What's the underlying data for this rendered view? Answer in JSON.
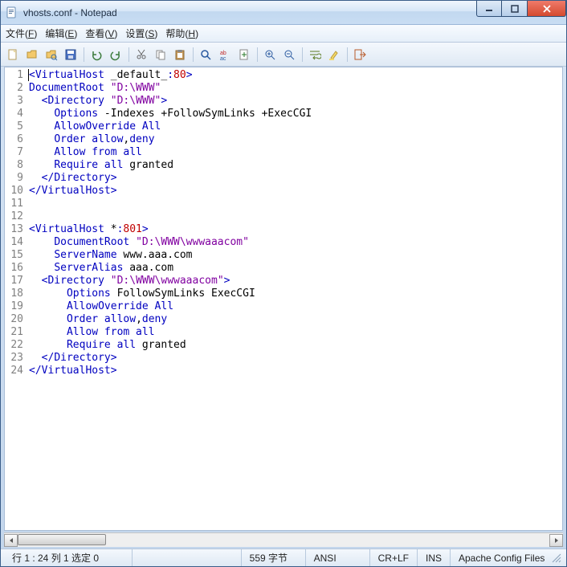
{
  "title": "vhosts.conf - Notepad",
  "menus": {
    "file": "文件(",
    "file_u": "F",
    "file_end": ")",
    "edit": "编辑(",
    "edit_u": "E",
    "edit_end": ")",
    "view": "查看(",
    "view_u": "V",
    "view_end": ")",
    "settings": "设置(",
    "settings_u": "S",
    "settings_end": ")",
    "help": "帮助(",
    "help_u": "H",
    "help_end": ")"
  },
  "lines": [
    {
      "n": 1,
      "tokens": [
        {
          "c": "c-tag",
          "t": "<"
        },
        {
          "c": "c-tag",
          "t": "VirtualHost"
        },
        {
          "c": "c-black",
          "t": " _default_"
        },
        {
          "c": "c-tag",
          "t": ":"
        },
        {
          "c": "c-red",
          "t": "80"
        },
        {
          "c": "c-tag",
          "t": ">"
        }
      ]
    },
    {
      "n": 2,
      "tokens": [
        {
          "c": "c-tag",
          "t": "DocumentRoot"
        },
        {
          "c": "c-black",
          "t": " "
        },
        {
          "c": "c-purple",
          "t": "\"D:\\WWW\""
        }
      ]
    },
    {
      "n": 3,
      "tokens": [
        {
          "c": "c-black",
          "t": "  "
        },
        {
          "c": "c-tag",
          "t": "<"
        },
        {
          "c": "c-tag",
          "t": "Directory"
        },
        {
          "c": "c-black",
          "t": " "
        },
        {
          "c": "c-purple",
          "t": "\"D:\\WWW\""
        },
        {
          "c": "c-tag",
          "t": ">"
        }
      ]
    },
    {
      "n": 4,
      "tokens": [
        {
          "c": "c-black",
          "t": "    "
        },
        {
          "c": "c-tag",
          "t": "Options"
        },
        {
          "c": "c-black",
          "t": " -Indexes +FollowSymLinks +ExecCGI"
        }
      ]
    },
    {
      "n": 5,
      "tokens": [
        {
          "c": "c-black",
          "t": "    "
        },
        {
          "c": "c-tag",
          "t": "AllowOverride All"
        }
      ]
    },
    {
      "n": 6,
      "tokens": [
        {
          "c": "c-black",
          "t": "    "
        },
        {
          "c": "c-tag",
          "t": "Order allow"
        },
        {
          "c": "c-black",
          "t": ","
        },
        {
          "c": "c-tag",
          "t": "deny"
        }
      ]
    },
    {
      "n": 7,
      "tokens": [
        {
          "c": "c-black",
          "t": "    "
        },
        {
          "c": "c-tag",
          "t": "Allow from all"
        }
      ]
    },
    {
      "n": 8,
      "tokens": [
        {
          "c": "c-black",
          "t": "    "
        },
        {
          "c": "c-tag",
          "t": "Require all"
        },
        {
          "c": "c-black",
          "t": " granted"
        }
      ]
    },
    {
      "n": 9,
      "tokens": [
        {
          "c": "c-black",
          "t": "  "
        },
        {
          "c": "c-tag",
          "t": "</"
        },
        {
          "c": "c-tag",
          "t": "Directory"
        },
        {
          "c": "c-tag",
          "t": ">"
        }
      ]
    },
    {
      "n": 10,
      "tokens": [
        {
          "c": "c-tag",
          "t": "</"
        },
        {
          "c": "c-tag",
          "t": "VirtualHost"
        },
        {
          "c": "c-tag",
          "t": ">"
        }
      ]
    },
    {
      "n": 11,
      "tokens": []
    },
    {
      "n": 12,
      "tokens": []
    },
    {
      "n": 13,
      "tokens": [
        {
          "c": "c-tag",
          "t": "<"
        },
        {
          "c": "c-tag",
          "t": "VirtualHost"
        },
        {
          "c": "c-black",
          "t": " *"
        },
        {
          "c": "c-tag",
          "t": ":"
        },
        {
          "c": "c-red",
          "t": "801"
        },
        {
          "c": "c-tag",
          "t": ">"
        }
      ]
    },
    {
      "n": 14,
      "tokens": [
        {
          "c": "c-black",
          "t": "    "
        },
        {
          "c": "c-tag",
          "t": "DocumentRoot"
        },
        {
          "c": "c-black",
          "t": " "
        },
        {
          "c": "c-purple",
          "t": "\"D:\\WWW\\wwwaaacom\""
        }
      ]
    },
    {
      "n": 15,
      "tokens": [
        {
          "c": "c-black",
          "t": "    "
        },
        {
          "c": "c-tag",
          "t": "ServerName"
        },
        {
          "c": "c-black",
          "t": " www.aaa.com"
        }
      ]
    },
    {
      "n": 16,
      "tokens": [
        {
          "c": "c-black",
          "t": "    "
        },
        {
          "c": "c-tag",
          "t": "ServerAlias"
        },
        {
          "c": "c-black",
          "t": " aaa.com"
        }
      ]
    },
    {
      "n": 17,
      "tokens": [
        {
          "c": "c-black",
          "t": "  "
        },
        {
          "c": "c-tag",
          "t": "<"
        },
        {
          "c": "c-tag",
          "t": "Directory"
        },
        {
          "c": "c-black",
          "t": " "
        },
        {
          "c": "c-purple",
          "t": "\"D:\\WWW\\wwwaaacom\""
        },
        {
          "c": "c-tag",
          "t": ">"
        }
      ]
    },
    {
      "n": 18,
      "tokens": [
        {
          "c": "c-black",
          "t": "      "
        },
        {
          "c": "c-tag",
          "t": "Options"
        },
        {
          "c": "c-black",
          "t": " FollowSymLinks ExecCGI"
        }
      ]
    },
    {
      "n": 19,
      "tokens": [
        {
          "c": "c-black",
          "t": "      "
        },
        {
          "c": "c-tag",
          "t": "AllowOverride All"
        }
      ]
    },
    {
      "n": 20,
      "tokens": [
        {
          "c": "c-black",
          "t": "      "
        },
        {
          "c": "c-tag",
          "t": "Order allow"
        },
        {
          "c": "c-black",
          "t": ","
        },
        {
          "c": "c-tag",
          "t": "deny"
        }
      ]
    },
    {
      "n": 21,
      "tokens": [
        {
          "c": "c-black",
          "t": "      "
        },
        {
          "c": "c-tag",
          "t": "Allow from all"
        }
      ]
    },
    {
      "n": 22,
      "tokens": [
        {
          "c": "c-black",
          "t": "      "
        },
        {
          "c": "c-tag",
          "t": "Require all"
        },
        {
          "c": "c-black",
          "t": " granted"
        }
      ]
    },
    {
      "n": 23,
      "tokens": [
        {
          "c": "c-black",
          "t": "  "
        },
        {
          "c": "c-tag",
          "t": "</"
        },
        {
          "c": "c-tag",
          "t": "Directory"
        },
        {
          "c": "c-tag",
          "t": ">"
        }
      ]
    },
    {
      "n": 24,
      "tokens": [
        {
          "c": "c-tag",
          "t": "</"
        },
        {
          "c": "c-tag",
          "t": "VirtualHost"
        },
        {
          "c": "c-tag",
          "t": ">"
        }
      ]
    }
  ],
  "status": {
    "pos": "行 1 : 24   列 1   选定 0",
    "bytes": "559 字节",
    "enc": "ANSI",
    "eol": "CR+LF",
    "mode": "INS",
    "lang": "Apache Config Files"
  },
  "icons": {
    "new": "new-file-icon",
    "open": "open-folder-icon",
    "openfolder": "folder-explore-icon",
    "save": "save-icon",
    "undo": "undo-icon",
    "redo": "redo-icon",
    "cut": "cut-icon",
    "copy": "copy-icon",
    "paste": "paste-icon",
    "find": "find-icon",
    "replace": "replace-icon",
    "goto": "goto-icon",
    "zoomin": "zoom-in-icon",
    "zoomout": "zoom-out-icon",
    "wrap": "wrap-icon",
    "highlight": "highlight-icon",
    "exit": "exit-icon"
  }
}
